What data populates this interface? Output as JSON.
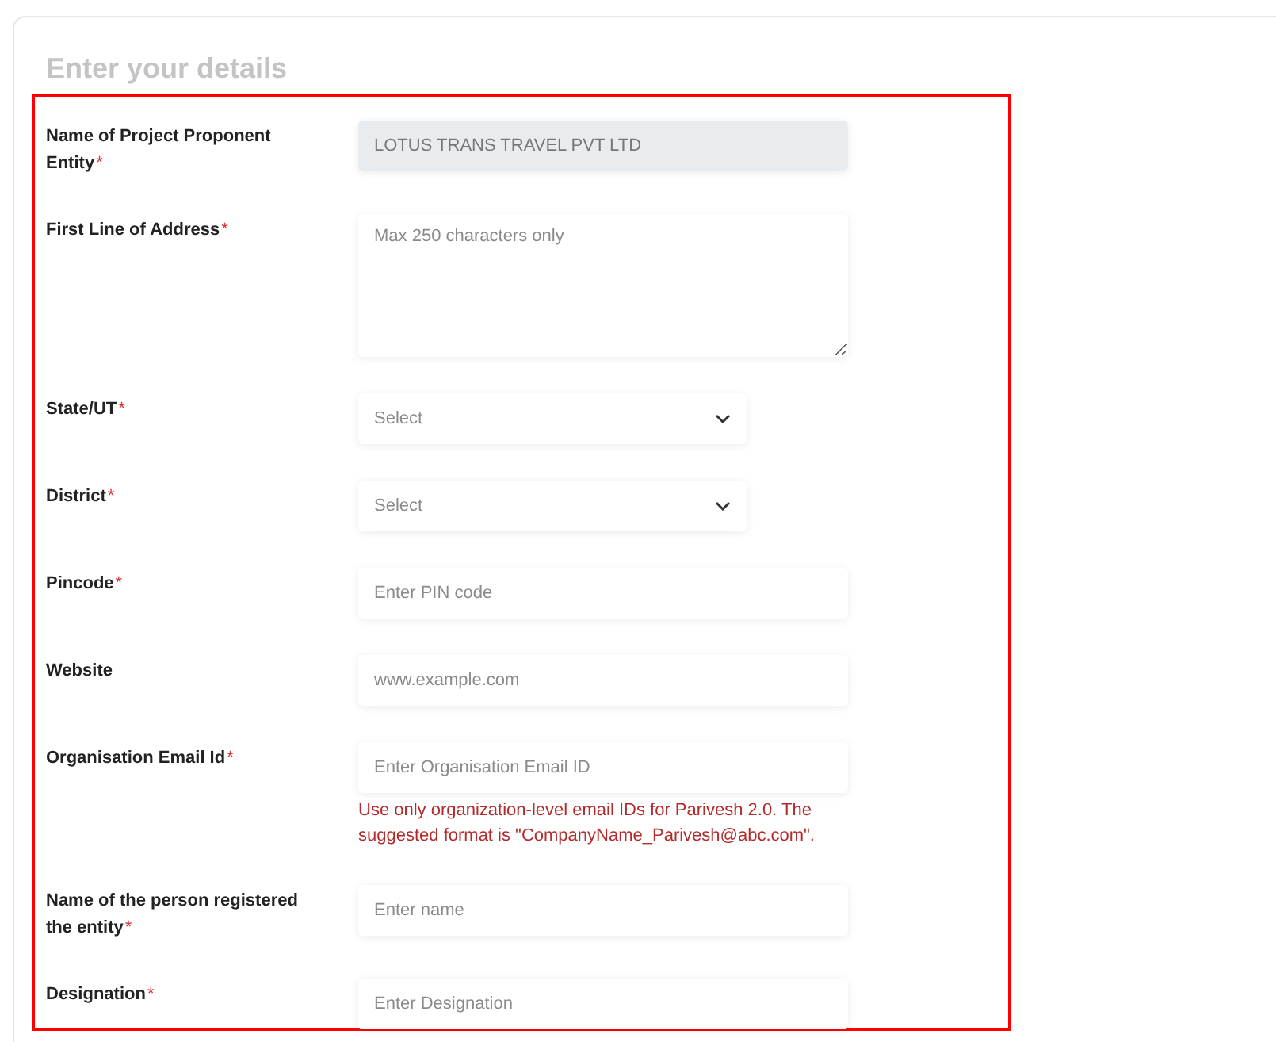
{
  "title": "Enter your details",
  "fields": [
    {
      "kind": "text",
      "label": "Name of Project Proponent Entity",
      "mark": "*",
      "value": "LOTUS TRANS TRAVEL PVT LTD",
      "disabled": true
    },
    {
      "kind": "textarea",
      "label": "First Line of Address",
      "mark": "*",
      "placeholder": "Max 250 characters only",
      "disabled": false
    },
    {
      "kind": "select",
      "label": "State/UT",
      "mark": "*",
      "placeholder": "Select",
      "disabled": false
    },
    {
      "kind": "select",
      "label": "District",
      "mark": "*",
      "placeholder": "Select",
      "disabled": false
    },
    {
      "kind": "text",
      "label": "Pincode",
      "mark": "*",
      "placeholder": "Enter PIN code",
      "disabled": false
    },
    {
      "kind": "text",
      "label": "Website",
      "placeholder": "www.example.com",
      "disabled": false
    },
    {
      "kind": "text",
      "label": "Organisation Email Id",
      "mark": "*",
      "placeholder": "Enter Organisation Email ID",
      "hint": "Use only organization-level email IDs for Parivesh 2.0. The suggested format is \"CompanyName_Parivesh@abc.com\".",
      "disabled": false
    },
    {
      "kind": "text",
      "label": "Name of the person registered the entity",
      "mark": "*",
      "placeholder": "Enter name",
      "disabled": false
    },
    {
      "kind": "text",
      "label": "Designation",
      "mark": "*",
      "placeholder": "Enter Designation",
      "disabled": false
    }
  ]
}
